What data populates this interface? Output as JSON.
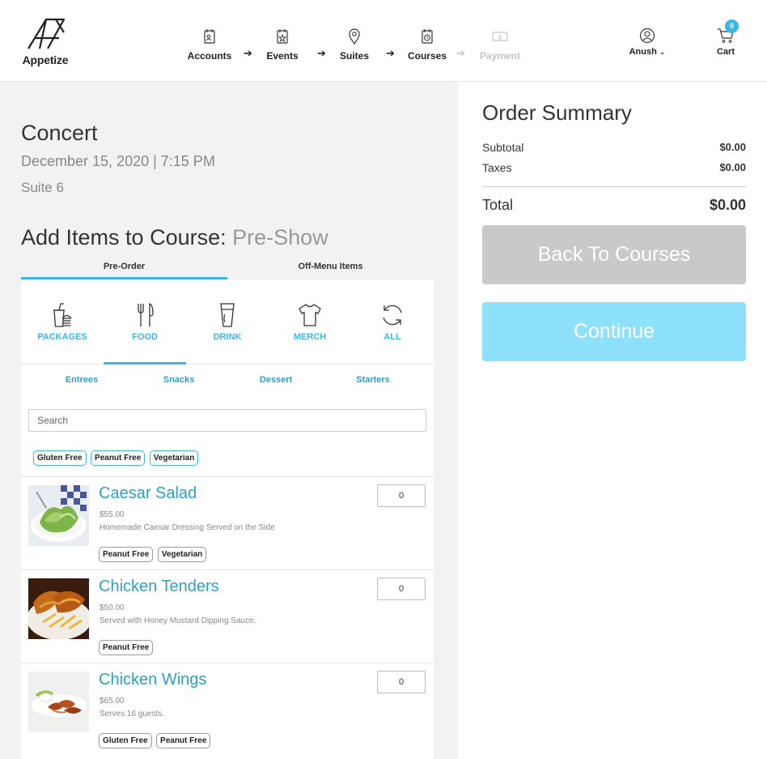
{
  "header": {
    "logo_text": "Appetize",
    "steps": [
      {
        "label": "Accounts",
        "icon": "accounts-icon",
        "enabled": true
      },
      {
        "label": "Events",
        "icon": "events-icon",
        "enabled": true
      },
      {
        "label": "Suites",
        "icon": "location-pin-icon",
        "enabled": true
      },
      {
        "label": "Courses",
        "icon": "courses-icon",
        "enabled": true
      },
      {
        "label": "Payment",
        "icon": "payment-icon",
        "enabled": false
      }
    ],
    "user_name": "Anush",
    "cart_label": "Cart",
    "cart_count": "0"
  },
  "event": {
    "title": "Concert",
    "datetime": "December 15, 2020 | 7:15 PM",
    "suite": "Suite 6"
  },
  "course": {
    "heading_prefix": "Add Items to Course:",
    "name": "Pre-Show"
  },
  "tabs": [
    {
      "label": "Pre-Order",
      "active": true
    },
    {
      "label": "Off-Menu Items",
      "active": false
    }
  ],
  "categories": [
    {
      "label": "PACKAGES",
      "icon": "packages-icon",
      "active": false
    },
    {
      "label": "FOOD",
      "icon": "food-icon",
      "active": true
    },
    {
      "label": "DRINK",
      "icon": "drink-icon",
      "active": false
    },
    {
      "label": "MERCH",
      "icon": "merch-icon",
      "active": false
    },
    {
      "label": "ALL",
      "icon": "refresh-icon",
      "active": false
    }
  ],
  "subcategories": [
    "Entrees",
    "Snacks",
    "Dessert",
    "Starters"
  ],
  "search": {
    "placeholder": "Search"
  },
  "filters": [
    "Gluten Free",
    "Peanut Free",
    "Vegetarian"
  ],
  "items": [
    {
      "name": "Caesar Salad",
      "price": "$55.00",
      "description": "Homemade Caesar Dressing Served on the Side",
      "tags": [
        "Peanut Free",
        "Vegetarian"
      ],
      "qty": "0"
    },
    {
      "name": "Chicken Tenders",
      "price": "$50.00",
      "description": "Served with Honey Mustard Dipping Sauce.",
      "tags": [
        "Peanut Free"
      ],
      "qty": "0"
    },
    {
      "name": "Chicken Wings",
      "price": "$65.00",
      "description": "Serves 16 guests.",
      "tags": [
        "Gluten Free",
        "Peanut Free"
      ],
      "qty": "0"
    }
  ],
  "summary": {
    "title": "Order Summary",
    "subtotal_label": "Subtotal",
    "subtotal_value": "$0.00",
    "taxes_label": "Taxes",
    "taxes_value": "$0.00",
    "total_label": "Total",
    "total_value": "$0.00",
    "back_button": "Back To Courses",
    "continue_button": "Continue"
  },
  "colors": {
    "accent": "#3bb8e6",
    "item_name": "#2f9fc2",
    "continue_bg": "#8ee1fa",
    "back_bg": "#c9c9c9",
    "left_bg": "#f2f2f2"
  }
}
